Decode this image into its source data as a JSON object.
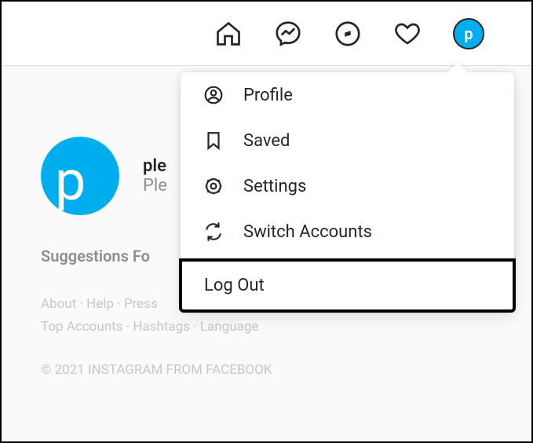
{
  "nav": {
    "avatar_letter": "p"
  },
  "profile": {
    "avatar_letter": "p",
    "username": "ple",
    "displayname": "Ple"
  },
  "suggestions": {
    "header": "Suggestions Fo"
  },
  "footer": {
    "links_row1": [
      "About",
      "Help",
      "Press"
    ],
    "links_row2": [
      "Top Accounts",
      "Hashtags",
      "Language"
    ],
    "copyright": "© 2021 Instagram from Facebook"
  },
  "menu": {
    "items": [
      {
        "label": "Profile"
      },
      {
        "label": "Saved"
      },
      {
        "label": "Settings"
      },
      {
        "label": "Switch Accounts"
      }
    ],
    "logout": "Log Out"
  }
}
